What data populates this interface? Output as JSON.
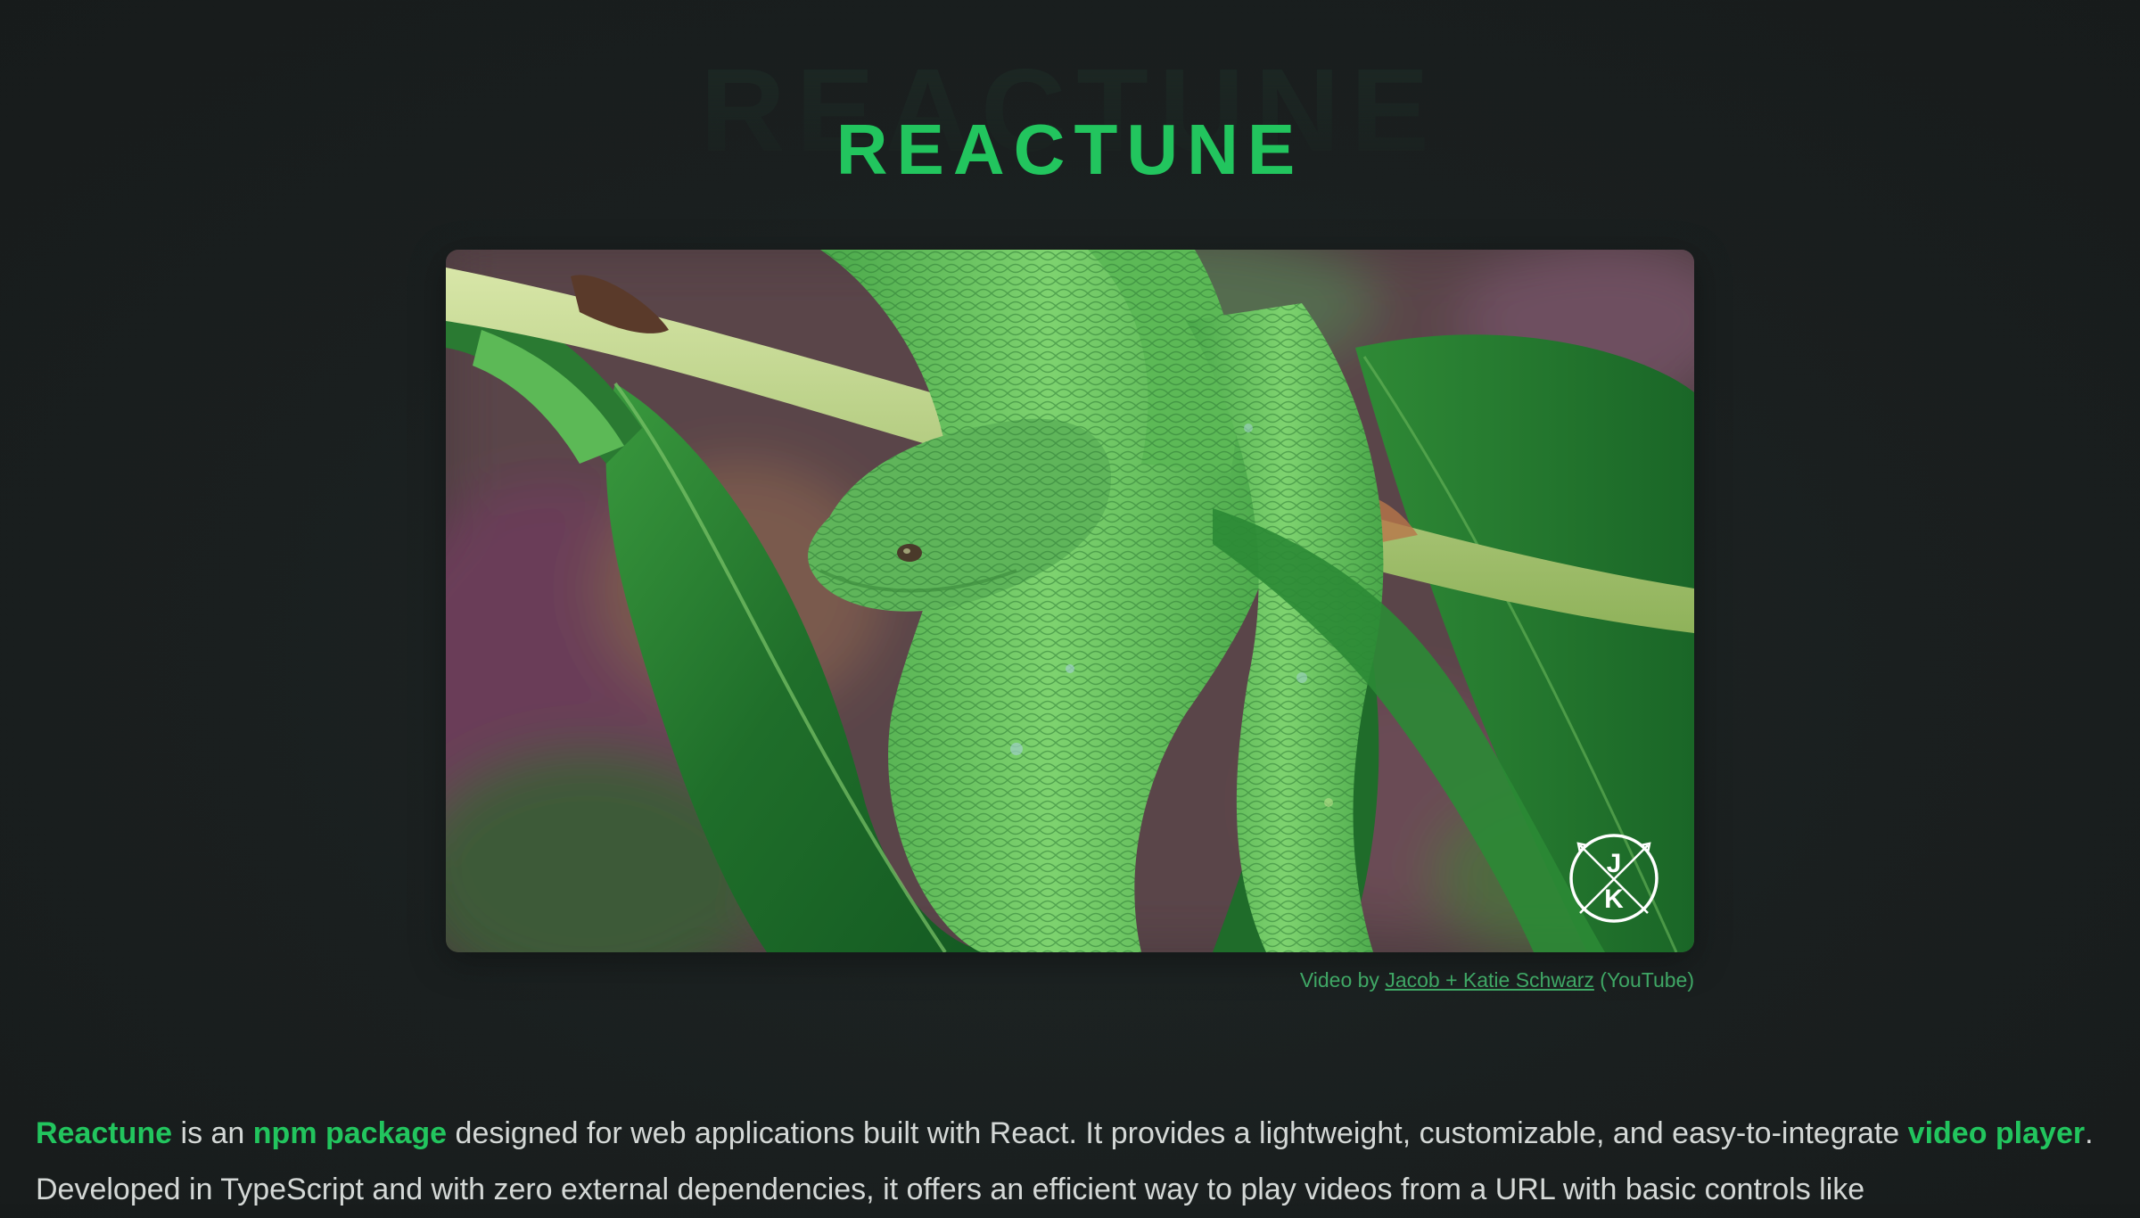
{
  "header": {
    "title": "REACTUNE",
    "title_shadow": "REACTUNE"
  },
  "video": {
    "subject": "green pit viper on leaf",
    "watermark": {
      "top_letter": "J",
      "bottom_letter": "K"
    }
  },
  "credit": {
    "prefix": "Video by ",
    "author_link": "Jacob + Katie Schwarz",
    "suffix": " (YouTube)"
  },
  "description": {
    "t1": "Reactune",
    "t2": " is an ",
    "t3": "npm package",
    "t4": " designed for web applications built with React. It provides a lightweight, customizable, and easy-to-integrate ",
    "t5": "video player",
    "t6": ". Developed in TypeScript and with zero external dependencies, it offers an efficient way to play videos from a URL with basic controls like"
  },
  "colors": {
    "accent": "#22c55e",
    "background": "#1b2020",
    "text": "#d4d8d6",
    "credit": "#3fa765"
  }
}
